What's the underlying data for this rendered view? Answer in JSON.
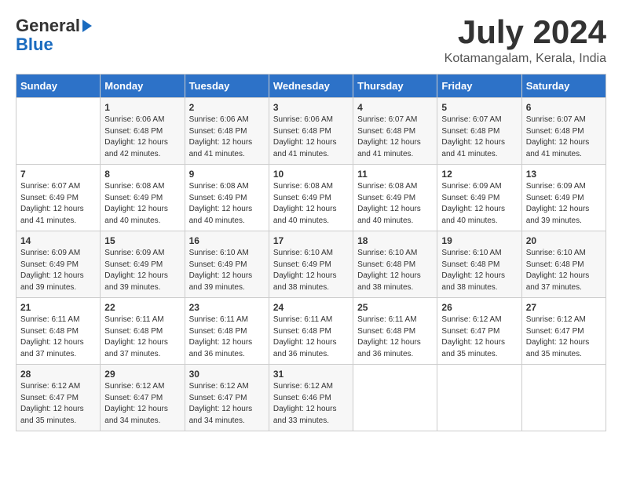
{
  "logo": {
    "general": "General",
    "blue": "Blue"
  },
  "title": "July 2024",
  "location": "Kotamangalam, Kerala, India",
  "weekdays": [
    "Sunday",
    "Monday",
    "Tuesday",
    "Wednesday",
    "Thursday",
    "Friday",
    "Saturday"
  ],
  "weeks": [
    [
      {
        "day": "",
        "info": ""
      },
      {
        "day": "1",
        "info": "Sunrise: 6:06 AM\nSunset: 6:48 PM\nDaylight: 12 hours\nand 42 minutes."
      },
      {
        "day": "2",
        "info": "Sunrise: 6:06 AM\nSunset: 6:48 PM\nDaylight: 12 hours\nand 41 minutes."
      },
      {
        "day": "3",
        "info": "Sunrise: 6:06 AM\nSunset: 6:48 PM\nDaylight: 12 hours\nand 41 minutes."
      },
      {
        "day": "4",
        "info": "Sunrise: 6:07 AM\nSunset: 6:48 PM\nDaylight: 12 hours\nand 41 minutes."
      },
      {
        "day": "5",
        "info": "Sunrise: 6:07 AM\nSunset: 6:48 PM\nDaylight: 12 hours\nand 41 minutes."
      },
      {
        "day": "6",
        "info": "Sunrise: 6:07 AM\nSunset: 6:48 PM\nDaylight: 12 hours\nand 41 minutes."
      }
    ],
    [
      {
        "day": "7",
        "info": "Sunrise: 6:07 AM\nSunset: 6:49 PM\nDaylight: 12 hours\nand 41 minutes."
      },
      {
        "day": "8",
        "info": "Sunrise: 6:08 AM\nSunset: 6:49 PM\nDaylight: 12 hours\nand 40 minutes."
      },
      {
        "day": "9",
        "info": "Sunrise: 6:08 AM\nSunset: 6:49 PM\nDaylight: 12 hours\nand 40 minutes."
      },
      {
        "day": "10",
        "info": "Sunrise: 6:08 AM\nSunset: 6:49 PM\nDaylight: 12 hours\nand 40 minutes."
      },
      {
        "day": "11",
        "info": "Sunrise: 6:08 AM\nSunset: 6:49 PM\nDaylight: 12 hours\nand 40 minutes."
      },
      {
        "day": "12",
        "info": "Sunrise: 6:09 AM\nSunset: 6:49 PM\nDaylight: 12 hours\nand 40 minutes."
      },
      {
        "day": "13",
        "info": "Sunrise: 6:09 AM\nSunset: 6:49 PM\nDaylight: 12 hours\nand 39 minutes."
      }
    ],
    [
      {
        "day": "14",
        "info": "Sunrise: 6:09 AM\nSunset: 6:49 PM\nDaylight: 12 hours\nand 39 minutes."
      },
      {
        "day": "15",
        "info": "Sunrise: 6:09 AM\nSunset: 6:49 PM\nDaylight: 12 hours\nand 39 minutes."
      },
      {
        "day": "16",
        "info": "Sunrise: 6:10 AM\nSunset: 6:49 PM\nDaylight: 12 hours\nand 39 minutes."
      },
      {
        "day": "17",
        "info": "Sunrise: 6:10 AM\nSunset: 6:49 PM\nDaylight: 12 hours\nand 38 minutes."
      },
      {
        "day": "18",
        "info": "Sunrise: 6:10 AM\nSunset: 6:48 PM\nDaylight: 12 hours\nand 38 minutes."
      },
      {
        "day": "19",
        "info": "Sunrise: 6:10 AM\nSunset: 6:48 PM\nDaylight: 12 hours\nand 38 minutes."
      },
      {
        "day": "20",
        "info": "Sunrise: 6:10 AM\nSunset: 6:48 PM\nDaylight: 12 hours\nand 37 minutes."
      }
    ],
    [
      {
        "day": "21",
        "info": "Sunrise: 6:11 AM\nSunset: 6:48 PM\nDaylight: 12 hours\nand 37 minutes."
      },
      {
        "day": "22",
        "info": "Sunrise: 6:11 AM\nSunset: 6:48 PM\nDaylight: 12 hours\nand 37 minutes."
      },
      {
        "day": "23",
        "info": "Sunrise: 6:11 AM\nSunset: 6:48 PM\nDaylight: 12 hours\nand 36 minutes."
      },
      {
        "day": "24",
        "info": "Sunrise: 6:11 AM\nSunset: 6:48 PM\nDaylight: 12 hours\nand 36 minutes."
      },
      {
        "day": "25",
        "info": "Sunrise: 6:11 AM\nSunset: 6:48 PM\nDaylight: 12 hours\nand 36 minutes."
      },
      {
        "day": "26",
        "info": "Sunrise: 6:12 AM\nSunset: 6:47 PM\nDaylight: 12 hours\nand 35 minutes."
      },
      {
        "day": "27",
        "info": "Sunrise: 6:12 AM\nSunset: 6:47 PM\nDaylight: 12 hours\nand 35 minutes."
      }
    ],
    [
      {
        "day": "28",
        "info": "Sunrise: 6:12 AM\nSunset: 6:47 PM\nDaylight: 12 hours\nand 35 minutes."
      },
      {
        "day": "29",
        "info": "Sunrise: 6:12 AM\nSunset: 6:47 PM\nDaylight: 12 hours\nand 34 minutes."
      },
      {
        "day": "30",
        "info": "Sunrise: 6:12 AM\nSunset: 6:47 PM\nDaylight: 12 hours\nand 34 minutes."
      },
      {
        "day": "31",
        "info": "Sunrise: 6:12 AM\nSunset: 6:46 PM\nDaylight: 12 hours\nand 33 minutes."
      },
      {
        "day": "",
        "info": ""
      },
      {
        "day": "",
        "info": ""
      },
      {
        "day": "",
        "info": ""
      }
    ]
  ]
}
